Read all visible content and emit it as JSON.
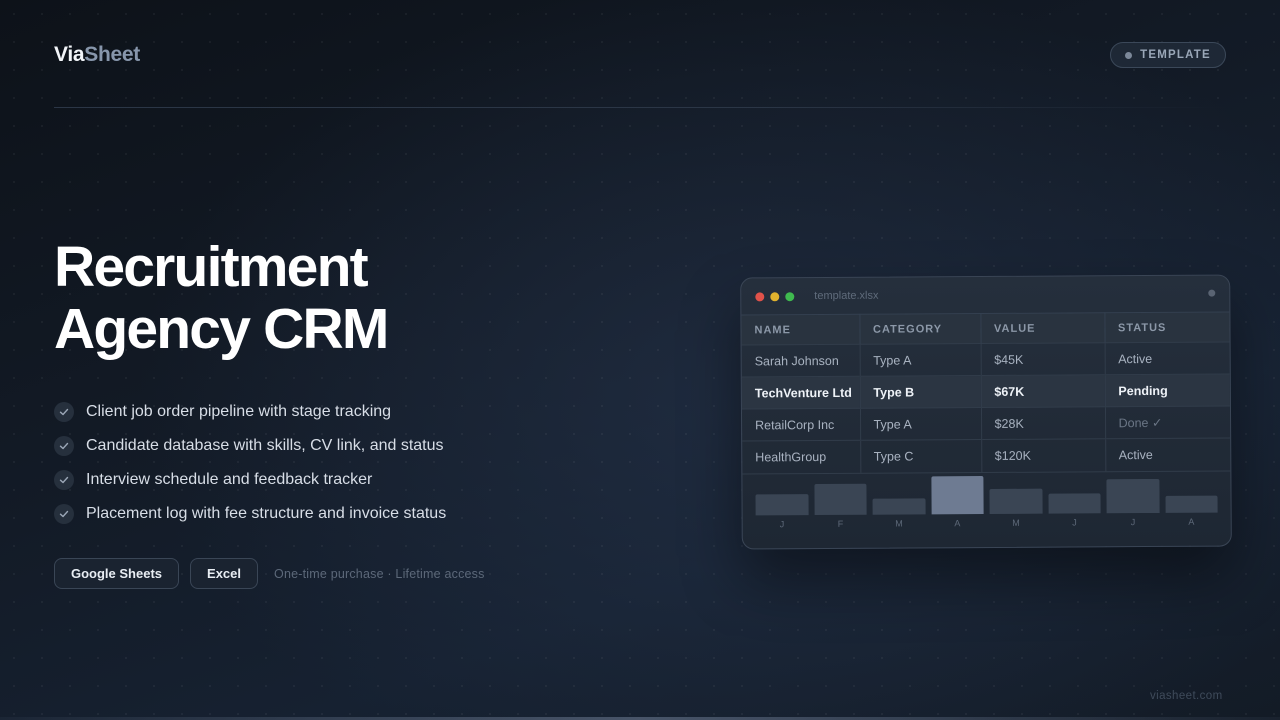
{
  "brand": {
    "part1": "Via",
    "part2": "Sheet"
  },
  "badge": {
    "label": "TEMPLATE"
  },
  "hero": {
    "line1": "Recruitment",
    "line2": "Agency CRM"
  },
  "features": [
    "Client job order pipeline with stage tracking",
    "Candidate database with skills, CV link, and status",
    "Interview schedule and feedback tracker",
    "Placement log with fee structure and invoice status"
  ],
  "actions": {
    "google_sheets_label": "Google Sheets",
    "excel_label": "Excel",
    "note": "One-time purchase · Lifetime access"
  },
  "footer": {
    "url": "viasheet.com"
  },
  "preview": {
    "filename": "template.xlsx",
    "columns": [
      "NAME",
      "CATEGORY",
      "VALUE",
      "STATUS"
    ],
    "rows": [
      {
        "name": "Sarah Johnson",
        "category": "Type A",
        "value": "$45K",
        "status": "Active"
      },
      {
        "name": "TechVenture Ltd",
        "category": "Type B",
        "value": "$67K",
        "status": "Pending"
      },
      {
        "name": "RetailCorp Inc",
        "category": "Type A",
        "value": "$28K",
        "status": "Done ✓"
      },
      {
        "name": "HealthGroup",
        "category": "Type C",
        "value": "$120K",
        "status": "Active"
      }
    ],
    "highlighted_row": 1,
    "chart": {
      "type": "bar",
      "categories": [
        "J",
        "F",
        "M",
        "A",
        "M",
        "J",
        "J",
        "A"
      ],
      "values": [
        20,
        29,
        15,
        36,
        24,
        19,
        32,
        16
      ],
      "highlighted_index": 3
    }
  },
  "colors": {
    "accent_bar": "#6e7b92",
    "bar": "#3a4554",
    "traffic_red": "#e0524a",
    "traffic_yellow": "#e0b22e",
    "traffic_green": "#3fba4f"
  },
  "icons": {
    "feature_bullet": "check-icon"
  }
}
